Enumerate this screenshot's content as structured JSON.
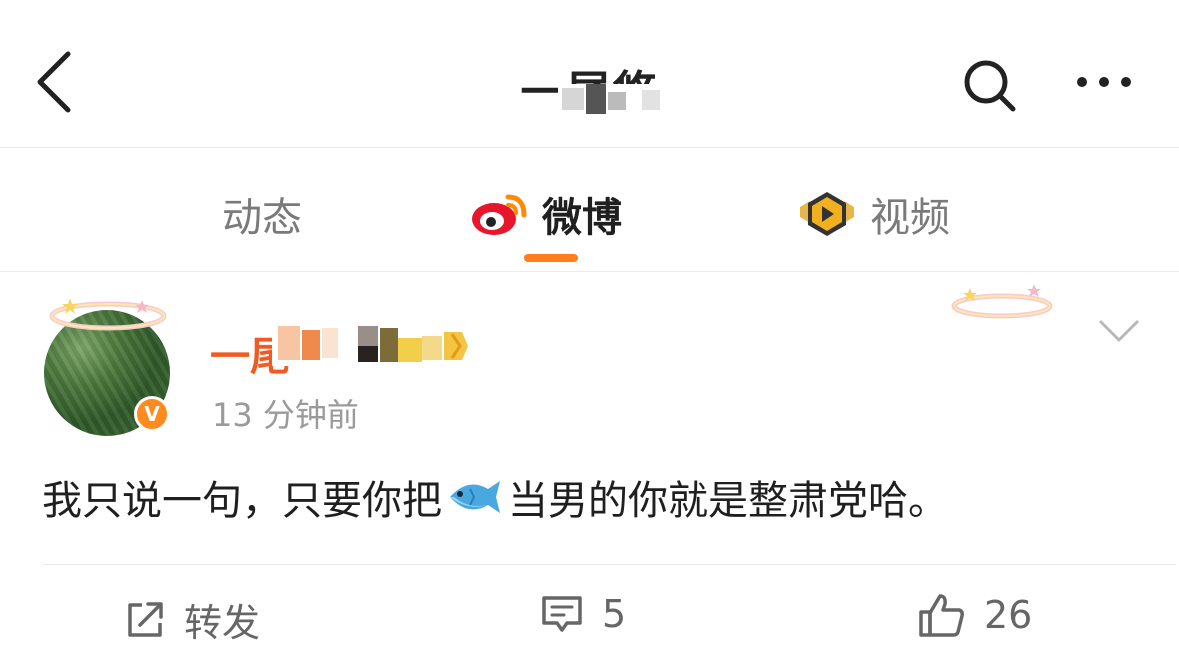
{
  "header": {
    "title": "一尾悠",
    "back_icon": "chevron-left-icon",
    "search_icon": "search-icon",
    "more_icon": "more-dots-icon"
  },
  "tabs": [
    {
      "label": "动态",
      "active": false
    },
    {
      "label": "微博",
      "active": true,
      "icon": "weibo-logo-icon"
    },
    {
      "label": "视频",
      "active": false,
      "icon": "video-badge-icon"
    }
  ],
  "post": {
    "username": "一尾",
    "verified_icon": "verified-v-icon",
    "timestamp": "13 分钟前",
    "content_before": "我只说一句，只要你把",
    "content_emoji": "fish-emoji",
    "content_after": "当男的你就是整肃党哈。",
    "actions": {
      "repost_label": "转发",
      "comment_count": "5",
      "like_count": "26"
    }
  },
  "colors": {
    "accent": "#ff7d1f",
    "username": "#f05b24",
    "muted": "#9a9a9a"
  }
}
